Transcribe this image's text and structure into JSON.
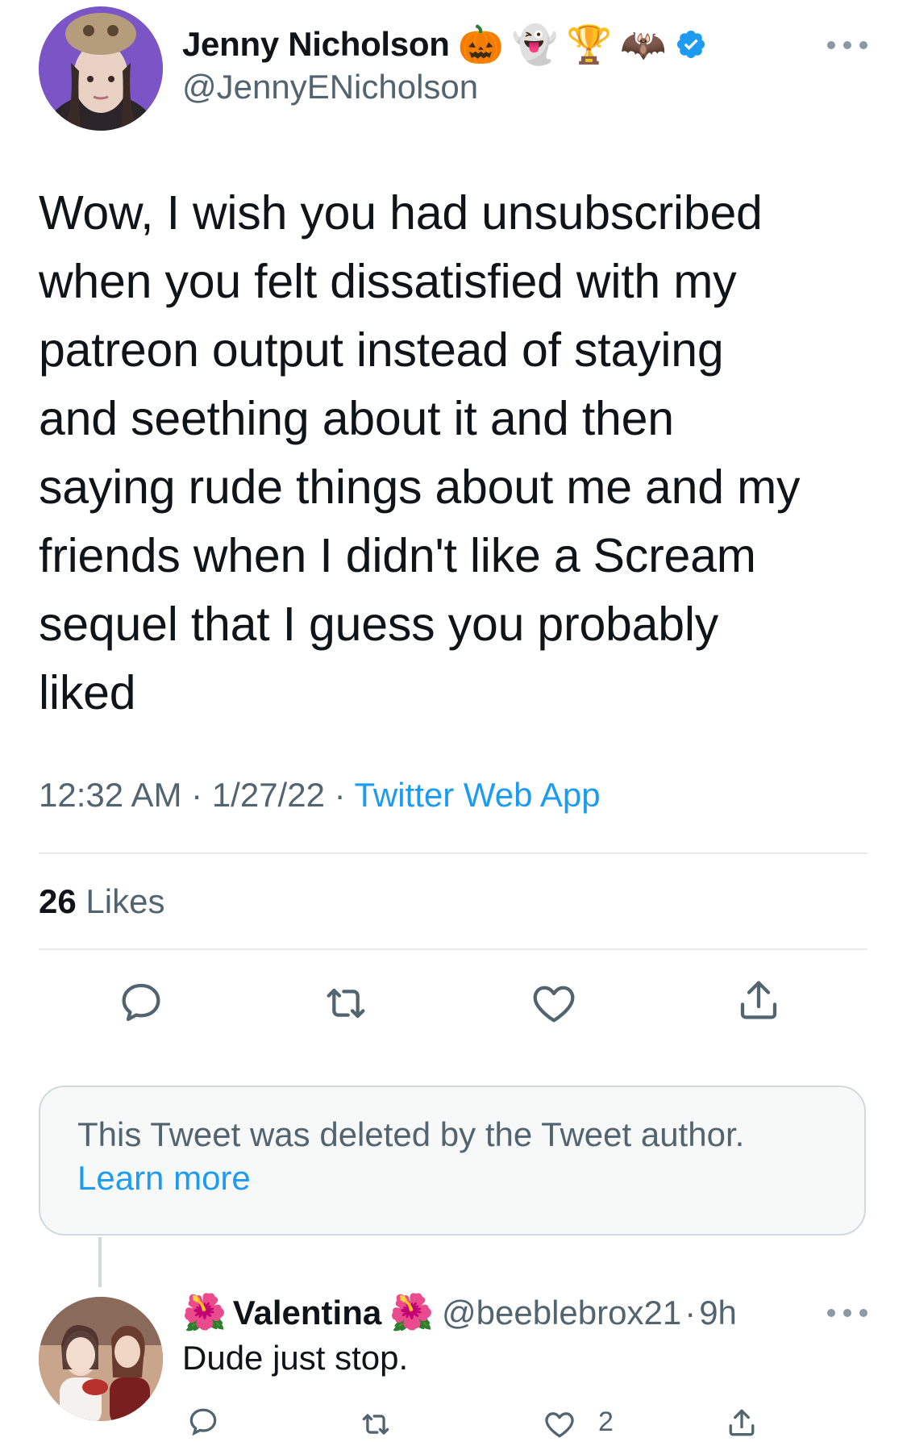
{
  "tweet": {
    "author": {
      "display_name": "Jenny Nicholson",
      "name_emojis": [
        "🎃",
        "👻",
        "🏆",
        "🦇"
      ],
      "verified": true,
      "handle": "@JennyENicholson"
    },
    "text": "Wow, I wish you had unsubscribed\nwhen you felt dissatisfied with my\npatreon output instead of staying\nand seething about it and then\nsaying rude things about me and my\nfriends when I didn't like a Scream\nsequel that I guess you probably\nliked",
    "time": "12:32 AM",
    "separator": "·",
    "date": "1/27/22",
    "source": "Twitter Web App",
    "likes_count": "26",
    "likes_label": "Likes"
  },
  "deleted_notice": {
    "text": "This Tweet was deleted by the Tweet author.",
    "link": "Learn more"
  },
  "reply": {
    "name_prefix_emoji": "🌺",
    "display_name": "Valentina",
    "name_suffix_emoji": "🌺",
    "handle": "@beeblebrox21",
    "separator": "·",
    "age": "9h",
    "text": "Dude just stop.",
    "like_count": "2"
  },
  "colors": {
    "link": "#1d9bf0",
    "secondary_text": "#536471",
    "primary_text": "#0f1419",
    "divider": "#e7e9ea"
  },
  "icons": {
    "reply": "reply-icon",
    "retweet": "retweet-icon",
    "like": "heart-icon",
    "share": "share-icon",
    "more": "more-icon",
    "verified": "verified-badge-icon"
  }
}
